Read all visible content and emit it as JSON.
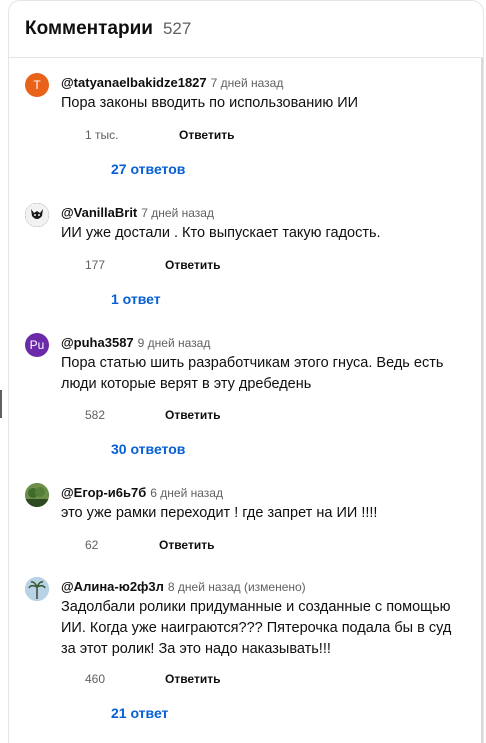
{
  "header": {
    "title": "Комментарии",
    "count": "527"
  },
  "comments": [
    {
      "avatar_letter": "T",
      "avatar_color": "#e8621a",
      "author": "@tatyanaelbakidze1827",
      "time": "7 дней назад",
      "text": "Пора законы вводить по использованию  ИИ",
      "likes": "1 тыс.",
      "reply_label": "Ответить",
      "replies_label": "27 ответов"
    },
    {
      "avatar_letter": "",
      "avatar_color": "#1f1f1f",
      "author": "@VanillaBrit",
      "time": "7 дней назад",
      "text": "ИИ уже достали .   Кто выпускает такую гадость.",
      "likes": "177",
      "reply_label": "Ответить",
      "replies_label": "1 ответ"
    },
    {
      "avatar_letter": "Pu",
      "avatar_color": "#6b2aa8",
      "author": "@puha3587",
      "time": "9 дней назад",
      "text": "Пора статью шить разработчикам этого гнуса. Ведь есть люди которые верят в эту дребедень",
      "likes": "582",
      "reply_label": "Ответить",
      "replies_label": "30 ответов"
    },
    {
      "avatar_letter": "",
      "avatar_color": "#4f7a3a",
      "author": "@Егор-и6ь7б",
      "time": "6 дней назад",
      "text": "это уже рамки переходит ! где запрет на ИИ !!!!",
      "likes": "62",
      "reply_label": "Ответить"
    },
    {
      "avatar_letter": "",
      "avatar_color": "#8fb3cf",
      "author": "@Алина-ю2ф3л",
      "time": "8 дней назад (изменено)",
      "text": "Задолбали  ролики придуманные и созданные с помощью ИИ. Когда уже наиграются??? Пятерочка подала бы в суд за этот ролик! За это надо наказывать!!!",
      "likes": "460",
      "reply_label": "Ответить",
      "replies_label": "21 ответ"
    }
  ]
}
